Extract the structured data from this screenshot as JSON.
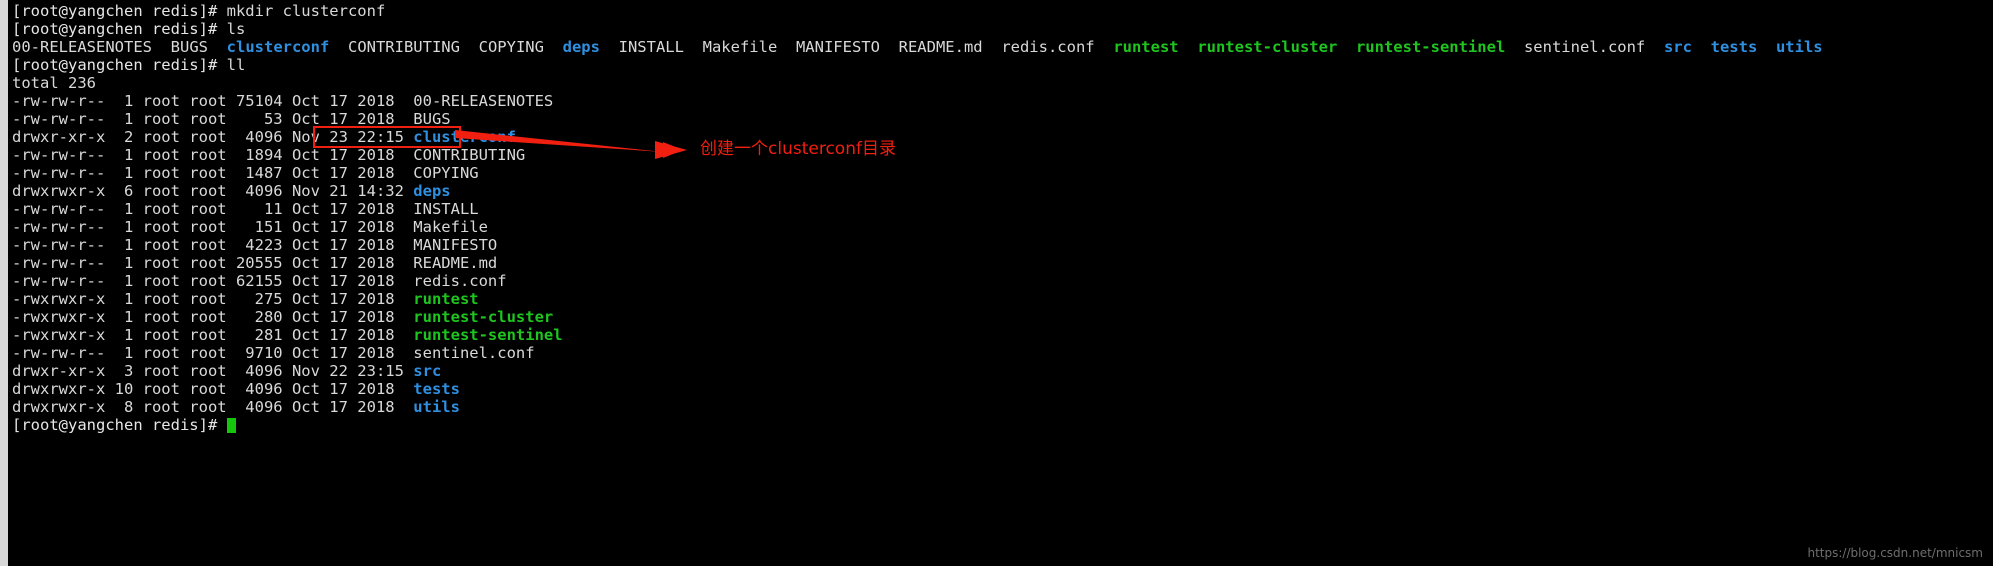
{
  "terminal": {
    "prompt": "[root@yangchen redis]# ",
    "colors": {
      "background": "#000000",
      "foreground": "#d9d9d9",
      "directory": "#2f8fe0",
      "executable": "#1fc51f",
      "annotation": "#f01f10",
      "cursor": "#16c60c"
    },
    "commands": {
      "mkdir": "mkdir clusterconf",
      "ls": "ls",
      "ll": "ll"
    },
    "ls_output": [
      {
        "name": "00-RELEASENOTES",
        "type": "file"
      },
      {
        "name": "BUGS",
        "type": "file"
      },
      {
        "name": "clusterconf",
        "type": "dir"
      },
      {
        "name": "CONTRIBUTING",
        "type": "file"
      },
      {
        "name": "COPYING",
        "type": "file"
      },
      {
        "name": "deps",
        "type": "dir"
      },
      {
        "name": "INSTALL",
        "type": "file"
      },
      {
        "name": "Makefile",
        "type": "file"
      },
      {
        "name": "MANIFESTO",
        "type": "file"
      },
      {
        "name": "README.md",
        "type": "file"
      },
      {
        "name": "redis.conf",
        "type": "file"
      },
      {
        "name": "runtest",
        "type": "exe"
      },
      {
        "name": "runtest-cluster",
        "type": "exe"
      },
      {
        "name": "runtest-sentinel",
        "type": "exe"
      },
      {
        "name": "sentinel.conf",
        "type": "file"
      },
      {
        "name": "src",
        "type": "dir"
      },
      {
        "name": "tests",
        "type": "dir"
      },
      {
        "name": "utils",
        "type": "dir"
      }
    ],
    "ll_total": "total 236",
    "ll_rows": [
      {
        "perms": "-rw-rw-r--",
        "links": "1",
        "owner": "root",
        "group": "root",
        "size": "75104",
        "month": "Oct",
        "day": "17",
        "time": "2018",
        "name": "00-RELEASENOTES",
        "type": "file"
      },
      {
        "perms": "-rw-rw-r--",
        "links": "1",
        "owner": "root",
        "group": "root",
        "size": "53",
        "month": "Oct",
        "day": "17",
        "time": "2018",
        "name": "BUGS",
        "type": "file"
      },
      {
        "perms": "drwxr-xr-x",
        "links": "2",
        "owner": "root",
        "group": "root",
        "size": "4096",
        "month": "Nov",
        "day": "23",
        "time": "22:15",
        "name": "clusterconf",
        "type": "dir"
      },
      {
        "perms": "-rw-rw-r--",
        "links": "1",
        "owner": "root",
        "group": "root",
        "size": "1894",
        "month": "Oct",
        "day": "17",
        "time": "2018",
        "name": "CONTRIBUTING",
        "type": "file"
      },
      {
        "perms": "-rw-rw-r--",
        "links": "1",
        "owner": "root",
        "group": "root",
        "size": "1487",
        "month": "Oct",
        "day": "17",
        "time": "2018",
        "name": "COPYING",
        "type": "file"
      },
      {
        "perms": "drwxrwxr-x",
        "links": "6",
        "owner": "root",
        "group": "root",
        "size": "4096",
        "month": "Nov",
        "day": "21",
        "time": "14:32",
        "name": "deps",
        "type": "dir"
      },
      {
        "perms": "-rw-rw-r--",
        "links": "1",
        "owner": "root",
        "group": "root",
        "size": "11",
        "month": "Oct",
        "day": "17",
        "time": "2018",
        "name": "INSTALL",
        "type": "file"
      },
      {
        "perms": "-rw-rw-r--",
        "links": "1",
        "owner": "root",
        "group": "root",
        "size": "151",
        "month": "Oct",
        "day": "17",
        "time": "2018",
        "name": "Makefile",
        "type": "file"
      },
      {
        "perms": "-rw-rw-r--",
        "links": "1",
        "owner": "root",
        "group": "root",
        "size": "4223",
        "month": "Oct",
        "day": "17",
        "time": "2018",
        "name": "MANIFESTO",
        "type": "file"
      },
      {
        "perms": "-rw-rw-r--",
        "links": "1",
        "owner": "root",
        "group": "root",
        "size": "20555",
        "month": "Oct",
        "day": "17",
        "time": "2018",
        "name": "README.md",
        "type": "file"
      },
      {
        "perms": "-rw-rw-r--",
        "links": "1",
        "owner": "root",
        "group": "root",
        "size": "62155",
        "month": "Oct",
        "day": "17",
        "time": "2018",
        "name": "redis.conf",
        "type": "file"
      },
      {
        "perms": "-rwxrwxr-x",
        "links": "1",
        "owner": "root",
        "group": "root",
        "size": "275",
        "month": "Oct",
        "day": "17",
        "time": "2018",
        "name": "runtest",
        "type": "exe"
      },
      {
        "perms": "-rwxrwxr-x",
        "links": "1",
        "owner": "root",
        "group": "root",
        "size": "280",
        "month": "Oct",
        "day": "17",
        "time": "2018",
        "name": "runtest-cluster",
        "type": "exe"
      },
      {
        "perms": "-rwxrwxr-x",
        "links": "1",
        "owner": "root",
        "group": "root",
        "size": "281",
        "month": "Oct",
        "day": "17",
        "time": "2018",
        "name": "runtest-sentinel",
        "type": "exe"
      },
      {
        "perms": "-rw-rw-r--",
        "links": "1",
        "owner": "root",
        "group": "root",
        "size": "9710",
        "month": "Oct",
        "day": "17",
        "time": "2018",
        "name": "sentinel.conf",
        "type": "file"
      },
      {
        "perms": "drwxr-xr-x",
        "links": "3",
        "owner": "root",
        "group": "root",
        "size": "4096",
        "month": "Nov",
        "day": "22",
        "time": "23:15",
        "name": "src",
        "type": "dir"
      },
      {
        "perms": "drwxrwxr-x",
        "links": "10",
        "owner": "root",
        "group": "root",
        "size": "4096",
        "month": "Oct",
        "day": "17",
        "time": "2018",
        "name": "tests",
        "type": "dir"
      },
      {
        "perms": "drwxrwxr-x",
        "links": "8",
        "owner": "root",
        "group": "root",
        "size": "4096",
        "month": "Oct",
        "day": "17",
        "time": "2018",
        "name": "utils",
        "type": "dir"
      }
    ]
  },
  "annotation": {
    "text": "创建一个clusterconf目录"
  },
  "watermark": {
    "text": "https://blog.csdn.net/mnicsm"
  }
}
